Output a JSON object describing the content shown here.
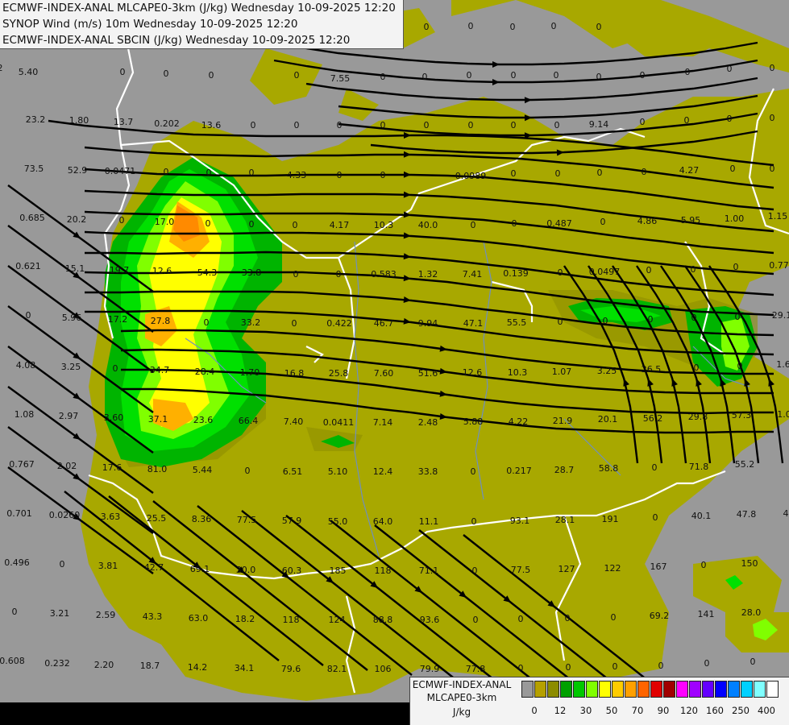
{
  "header": {
    "lines": [
      "ECMWF-INDEX-ANAL MLCAPE0-3km (J/kg) Wednesday 10-09-2025 12:20",
      "SYNOP Wind (m/s) 10m Wednesday 10-09-2025 12:20",
      "ECMWF-INDEX-ANAL SBCIN (J/kg) Wednesday 10-09-2025 12:20"
    ]
  },
  "legend": {
    "title_lines": [
      "ECMWF-INDEX-ANAL",
      "MLCAPE0-3km",
      "J/kg"
    ],
    "colors": [
      "#999999",
      "#b5a000",
      "#8c8c00",
      "#00a000",
      "#00c800",
      "#80ff00",
      "#ffff00",
      "#ffcc00",
      "#ffa000",
      "#ff6400",
      "#e10000",
      "#a00000",
      "#ff00ff",
      "#a000ff",
      "#6400ff",
      "#0000ff",
      "#0080ff",
      "#00d0ff",
      "#80ffff",
      "#ffffff"
    ],
    "ticks": [
      "0",
      "12",
      "30",
      "50",
      "70",
      "90",
      "120",
      "160",
      "250",
      "400"
    ]
  },
  "colors": {
    "background": "#999999",
    "cape_low": "#a8a800",
    "border": "#ffffff",
    "river": "#6f8fbf",
    "streamline": "#000000"
  },
  "map_values": [
    [
      "5.40",
      35,
      93
    ],
    [
      "0",
      152,
      93
    ],
    [
      "0",
      206,
      95
    ],
    [
      "0",
      262,
      97
    ],
    [
      "0",
      368,
      97
    ],
    [
      "7.55",
      422,
      101
    ],
    [
      "0",
      475,
      99
    ],
    [
      "0",
      527,
      99
    ],
    [
      "0",
      582,
      97
    ],
    [
      "0",
      637,
      97
    ],
    [
      "0",
      690,
      97
    ],
    [
      "0",
      743,
      99
    ],
    [
      "0",
      797,
      97
    ],
    [
      "0",
      853,
      93
    ],
    [
      "0",
      905,
      89
    ],
    [
      "0",
      958,
      88
    ],
    [
      "2",
      0,
      88
    ],
    [
      "0",
      529,
      37
    ],
    [
      "0",
      584,
      36
    ],
    [
      "0",
      636,
      37
    ],
    [
      "0",
      687,
      36
    ],
    [
      "0",
      743,
      37
    ],
    [
      "23.2",
      44,
      152
    ],
    [
      "1.80",
      98,
      153
    ],
    [
      "13.7",
      153,
      155
    ],
    [
      "0.202",
      207,
      157
    ],
    [
      "13.6",
      262,
      159
    ],
    [
      "0",
      314,
      159
    ],
    [
      "0",
      368,
      159
    ],
    [
      "0",
      421,
      159
    ],
    [
      "0",
      475,
      159
    ],
    [
      "0",
      529,
      159
    ],
    [
      "0",
      584,
      159
    ],
    [
      "0",
      637,
      159
    ],
    [
      "0",
      691,
      159
    ],
    [
      "9.14",
      743,
      158
    ],
    [
      "0",
      797,
      155
    ],
    [
      "0",
      852,
      153
    ],
    [
      "0",
      905,
      151
    ],
    [
      "0",
      958,
      150
    ],
    [
      "73.5",
      42,
      213
    ],
    [
      "52.9",
      96,
      215
    ],
    [
      "0.0471",
      149,
      216
    ],
    [
      "0",
      206,
      217
    ],
    [
      "0",
      259,
      218
    ],
    [
      "0",
      312,
      218
    ],
    [
      "4.33",
      368,
      221
    ],
    [
      "0",
      421,
      221
    ],
    [
      "0",
      475,
      221
    ],
    [
      "0.0989",
      584,
      222
    ],
    [
      "0",
      637,
      219
    ],
    [
      "0",
      692,
      219
    ],
    [
      "0",
      744,
      218
    ],
    [
      "0",
      799,
      217
    ],
    [
      "4.27",
      855,
      215
    ],
    [
      "0",
      909,
      213
    ],
    [
      "0",
      958,
      213
    ],
    [
      "0.685",
      40,
      274
    ],
    [
      "20.2",
      95,
      276
    ],
    [
      "0",
      151,
      277
    ],
    [
      "17.0",
      204,
      279
    ],
    [
      "0",
      258,
      281
    ],
    [
      "0",
      312,
      282
    ],
    [
      "0",
      366,
      283
    ],
    [
      "4.17",
      421,
      283
    ],
    [
      "10.3",
      476,
      283
    ],
    [
      "40.0",
      531,
      283
    ],
    [
      "0",
      587,
      283
    ],
    [
      "0",
      638,
      281
    ],
    [
      "0.487",
      694,
      281
    ],
    [
      "0",
      748,
      279
    ],
    [
      "4.86",
      803,
      278
    ],
    [
      "5.95",
      857,
      277
    ],
    [
      "1.00",
      911,
      275
    ],
    [
      "1.15",
      965,
      272
    ],
    [
      "0.621",
      35,
      334
    ],
    [
      "15.1",
      93,
      337
    ],
    [
      "19.7",
      148,
      339
    ],
    [
      "12.6",
      201,
      340
    ],
    [
      "54.3",
      257,
      342
    ],
    [
      "33.8",
      312,
      342
    ],
    [
      "0",
      367,
      344
    ],
    [
      "0",
      420,
      344
    ],
    [
      "0.583",
      476,
      344
    ],
    [
      "1.32",
      531,
      344
    ],
    [
      "7.41",
      586,
      344
    ],
    [
      "0.139",
      640,
      343
    ],
    [
      "0",
      695,
      342
    ],
    [
      "0.0497",
      750,
      341
    ],
    [
      "0",
      805,
      339
    ],
    [
      "0",
      860,
      338
    ],
    [
      "0",
      913,
      335
    ],
    [
      "0.772",
      970,
      333
    ],
    [
      "0",
      35,
      395
    ],
    [
      "5.96",
      89,
      398
    ],
    [
      "17.2",
      146,
      400
    ],
    [
      "27.8",
      199,
      402
    ],
    [
      "0",
      256,
      404
    ],
    [
      "33.2",
      311,
      404
    ],
    [
      "0",
      365,
      405
    ],
    [
      "0.422",
      421,
      405
    ],
    [
      "46.7",
      476,
      405
    ],
    [
      "9.94",
      531,
      405
    ],
    [
      "47.1",
      587,
      405
    ],
    [
      "55.5",
      641,
      404
    ],
    [
      "0",
      695,
      403
    ],
    [
      "0",
      751,
      402
    ],
    [
      "0",
      807,
      400
    ],
    [
      "0",
      861,
      398
    ],
    [
      "0",
      915,
      397
    ],
    [
      "29.1",
      970,
      395
    ],
    [
      "4.08",
      32,
      457
    ],
    [
      "3.25",
      88,
      459
    ],
    [
      "0",
      143,
      461
    ],
    [
      "34.7",
      198,
      463
    ],
    [
      "28.4",
      254,
      465
    ],
    [
      "1.70",
      310,
      466
    ],
    [
      "16.8",
      365,
      467
    ],
    [
      "25.8",
      420,
      467
    ],
    [
      "7.60",
      476,
      467
    ],
    [
      "51.6",
      531,
      467
    ],
    [
      "12.6",
      586,
      466
    ],
    [
      "10.3",
      642,
      466
    ],
    [
      "1.07",
      697,
      465
    ],
    [
      "3.25",
      753,
      464
    ],
    [
      "26.5",
      808,
      462
    ],
    [
      "0",
      864,
      460
    ],
    [
      "0",
      918,
      458
    ],
    [
      "1.6",
      972,
      456
    ],
    [
      "1.08",
      30,
      518
    ],
    [
      "2.97",
      85,
      520
    ],
    [
      "3.60",
      141,
      522
    ],
    [
      "37.1",
      196,
      524
    ],
    [
      "23.6",
      252,
      525
    ],
    [
      "66.4",
      308,
      526
    ],
    [
      "7.40",
      364,
      527
    ],
    [
      "0.0411",
      420,
      528
    ],
    [
      "7.14",
      475,
      528
    ],
    [
      "2.48",
      531,
      528
    ],
    [
      "5.88",
      587,
      527
    ],
    [
      "4.22",
      643,
      527
    ],
    [
      "21.9",
      698,
      526
    ],
    [
      "20.1",
      754,
      524
    ],
    [
      "56.2",
      810,
      523
    ],
    [
      "29.8",
      866,
      521
    ],
    [
      "57.3",
      920,
      519
    ],
    [
      "1.0",
      973,
      518
    ],
    [
      "0.767",
      27,
      580
    ],
    [
      "2.02",
      83,
      582
    ],
    [
      "17.6",
      139,
      584
    ],
    [
      "81.0",
      195,
      586
    ],
    [
      "5.44",
      251,
      587
    ],
    [
      "0",
      307,
      588
    ],
    [
      "6.51",
      363,
      589
    ],
    [
      "5.10",
      419,
      589
    ],
    [
      "12.4",
      475,
      589
    ],
    [
      "33.8",
      531,
      589
    ],
    [
      "0",
      587,
      589
    ],
    [
      "0.217",
      644,
      588
    ],
    [
      "28.7",
      700,
      587
    ],
    [
      "58.8",
      755,
      585
    ],
    [
      "0",
      812,
      584
    ],
    [
      "71.8",
      867,
      583
    ],
    [
      "55.2",
      924,
      580
    ],
    [
      "0.701",
      24,
      641
    ],
    [
      "0.0260",
      80,
      643
    ],
    [
      "3.63",
      137,
      645
    ],
    [
      "25.5",
      194,
      647
    ],
    [
      "8.36",
      250,
      648
    ],
    [
      "77.5",
      306,
      649
    ],
    [
      "57.9",
      362,
      650
    ],
    [
      "55.0",
      419,
      651
    ],
    [
      "64.0",
      475,
      651
    ],
    [
      "11.1",
      532,
      651
    ],
    [
      "0",
      588,
      651
    ],
    [
      "93.1",
      645,
      650
    ],
    [
      "28.1",
      701,
      649
    ],
    [
      "191",
      757,
      648
    ],
    [
      "0",
      813,
      646
    ],
    [
      "40.1",
      870,
      644
    ],
    [
      "47.8",
      926,
      642
    ],
    [
      "4",
      975,
      641
    ],
    [
      "0.496",
      21,
      702
    ],
    [
      "0",
      77,
      704
    ],
    [
      "3.81",
      134,
      706
    ],
    [
      "42.7",
      191,
      708
    ],
    [
      "69.1",
      248,
      710
    ],
    [
      "30.0",
      305,
      711
    ],
    [
      "60.3",
      362,
      712
    ],
    [
      "185",
      419,
      712
    ],
    [
      "118",
      475,
      712
    ],
    [
      "71.1",
      532,
      712
    ],
    [
      "0",
      589,
      712
    ],
    [
      "77.5",
      646,
      711
    ],
    [
      "127",
      703,
      710
    ],
    [
      "122",
      760,
      709
    ],
    [
      "167",
      817,
      707
    ],
    [
      "0",
      873,
      705
    ],
    [
      "150",
      930,
      703
    ],
    [
      "0",
      18,
      763
    ],
    [
      "3.21",
      74,
      765
    ],
    [
      "2.59",
      131,
      767
    ],
    [
      "43.3",
      189,
      769
    ],
    [
      "63.0",
      246,
      771
    ],
    [
      "18.2",
      304,
      772
    ],
    [
      "118",
      361,
      773
    ],
    [
      "124",
      418,
      773
    ],
    [
      "88.8",
      475,
      773
    ],
    [
      "93.6",
      533,
      773
    ],
    [
      "0",
      590,
      773
    ],
    [
      "0",
      646,
      772
    ],
    [
      "0",
      704,
      771
    ],
    [
      "0",
      761,
      770
    ],
    [
      "69.2",
      818,
      768
    ],
    [
      "141",
      876,
      766
    ],
    [
      "28.0",
      932,
      764
    ],
    [
      "0.608",
      15,
      824
    ],
    [
      "0.232",
      71,
      827
    ],
    [
      "2.20",
      129,
      829
    ],
    [
      "18.7",
      186,
      830
    ],
    [
      "14.2",
      245,
      832
    ],
    [
      "34.1",
      303,
      833
    ],
    [
      "79.6",
      361,
      834
    ],
    [
      "82.1",
      418,
      834
    ],
    [
      "106",
      475,
      834
    ],
    [
      "79.9",
      533,
      834
    ],
    [
      "77.8",
      590,
      834
    ],
    [
      "0",
      646,
      833
    ],
    [
      "0",
      705,
      832
    ],
    [
      "0",
      763,
      831
    ],
    [
      "0",
      820,
      830
    ],
    [
      "0",
      877,
      827
    ],
    [
      "0",
      934,
      825
    ]
  ]
}
